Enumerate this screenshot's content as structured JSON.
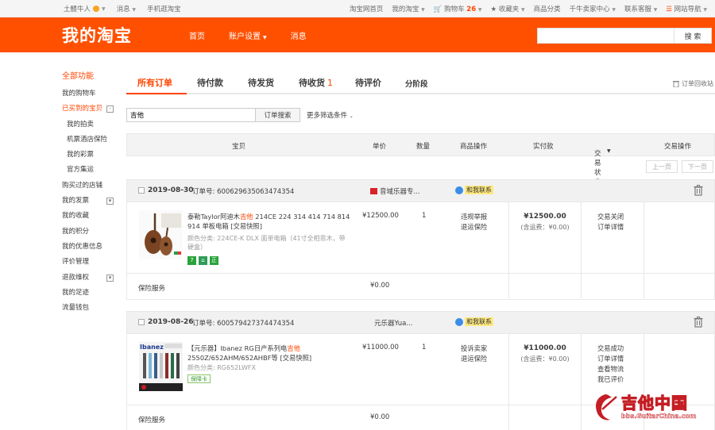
{
  "topbar": {
    "username": "土髅牛人",
    "messages": "消息",
    "mobile": "手机逛淘宝",
    "home": "淘宝网首页",
    "mytaobao": "我的淘宝",
    "cart_label": "购物车",
    "cart_count": "26",
    "favorites": "收藏夹",
    "categories": "商品分类",
    "seller": "千牛卖家中心",
    "service": "联系客服",
    "sitenav": "网站导航"
  },
  "header": {
    "logo": "我的淘宝",
    "nav": [
      "首页",
      "账户设置",
      "消息"
    ],
    "search_placeholder": "",
    "search_button": "搜 索"
  },
  "sidebar": {
    "title": "全部功能",
    "items": [
      {
        "label": "我的购物车"
      },
      {
        "label": "已买到的宝贝",
        "active": true,
        "expand": "-"
      },
      {
        "label": "我的拍卖",
        "sub": true
      },
      {
        "label": "机票酒店保险",
        "sub": true
      },
      {
        "label": "我的彩票",
        "sub": true
      },
      {
        "label": "官方集运",
        "sub": true
      },
      {
        "label": "购买过的店铺"
      },
      {
        "label": "我的发票",
        "expand": "▾"
      },
      {
        "label": "我的收藏"
      },
      {
        "label": "我的积分"
      },
      {
        "label": "我的优惠信息"
      },
      {
        "label": "评价管理"
      },
      {
        "label": "退款维权",
        "expand": "▾"
      },
      {
        "label": "我的足迹"
      },
      {
        "label": "流量钱包"
      }
    ]
  },
  "tabs": {
    "all": "所有订单",
    "unpaid": "待付款",
    "unshipped": "待发货",
    "unreceived": "待收货",
    "unreceived_count": "1",
    "unreviewed": "待评价",
    "installment": "分阶段",
    "recycle": "订单回收站"
  },
  "filter": {
    "query": "吉他",
    "search_button": "订单搜索",
    "more": "更多筛选条件"
  },
  "columns": {
    "item": "宝贝",
    "price": "单价",
    "qty": "数量",
    "ops": "商品操作",
    "paid": "实付款",
    "status": "交易状态",
    "actions": "交易操作"
  },
  "pager": {
    "prev": "上一页",
    "next": "下一页"
  },
  "orders": [
    {
      "date": "2019-08-30",
      "order_no": "订单号: 600629635063474354",
      "shop": "音域乐器专...",
      "chat": "和我联系",
      "title_a": "泰勒Taylor阿迪木",
      "title_hl": "吉他",
      "title_b": " 214CE 224 314 414 714 814 914 单板电箱 [交易快照]",
      "attr": "颜色分类: 224CE-K DLX 面单电箱（41寸全相思木，带硬盒）",
      "tags": [
        "7",
        "⌂",
        "正"
      ],
      "price": "¥12500.00",
      "qty": "1",
      "ops": [
        "违规举报",
        "退运保险"
      ],
      "paid": "¥12500.00",
      "ship": "(含运费：¥0.00)",
      "status": [
        "交易关闭",
        "订单详情"
      ],
      "footer_label": "保险服务",
      "footer_amount": "¥0.00"
    },
    {
      "date": "2019-08-26",
      "order_no": "订单号: 600579427374474354",
      "shop": "元乐器Yua...",
      "chat": "和我联系",
      "title_a": "【元乐器】Ibanez RG日产系列电",
      "title_hl": "吉他",
      "title_b": " 2550Z/652AHM/652AHBF等 [交易快照]",
      "attr": "颜色分类: RG652LWFX",
      "tags": [
        "保障卡"
      ],
      "price": "¥11000.00",
      "qty": "1",
      "ops": [
        "投诉卖家",
        "退运保险"
      ],
      "paid": "¥11000.00",
      "ship": "(含运费：¥0.00)",
      "status": [
        "交易成功",
        "订单详情",
        "查看物流",
        "我已评价"
      ],
      "footer_label": "保险服务",
      "footer_amount": "¥0.00"
    }
  ],
  "watermark": {
    "title": "吉他中国",
    "site": "bbs.GuitarChina.com"
  },
  "colors": {
    "brand": "#ff5000",
    "accent": "#f40"
  }
}
